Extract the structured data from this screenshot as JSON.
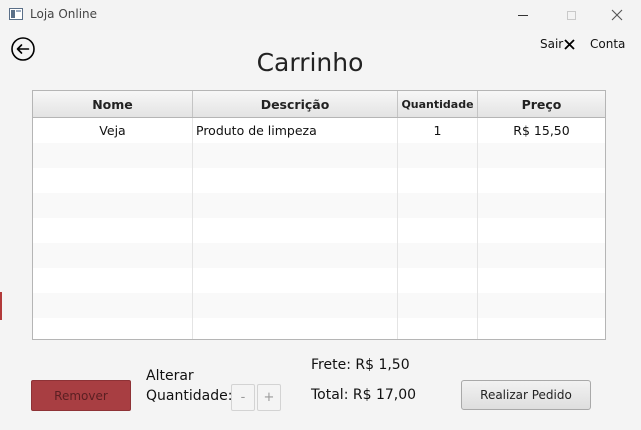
{
  "window": {
    "title": "Loja Online"
  },
  "header": {
    "title": "Carrinho",
    "sair_label": "Sair",
    "conta_label": "Conta"
  },
  "table": {
    "columns": [
      "Nome",
      "Descrição",
      "Quantidade",
      "Preço"
    ],
    "rows": [
      {
        "nome": "Veja",
        "descricao": "Produto de limpeza",
        "quantidade": "1",
        "preco": "R$ 15,50"
      }
    ]
  },
  "actions": {
    "remove_label": "Remover",
    "qty_label_line1": "Alterar",
    "qty_label_line2": "Quantidade:",
    "minus_label": "-",
    "plus_label": "+",
    "order_label": "Realizar Pedido"
  },
  "summary": {
    "frete": "Frete: R$ 1,50",
    "total": "Total: R$ 17,00"
  },
  "colors": {
    "remove_button": "#a83e42",
    "background": "#f4f4f4"
  }
}
